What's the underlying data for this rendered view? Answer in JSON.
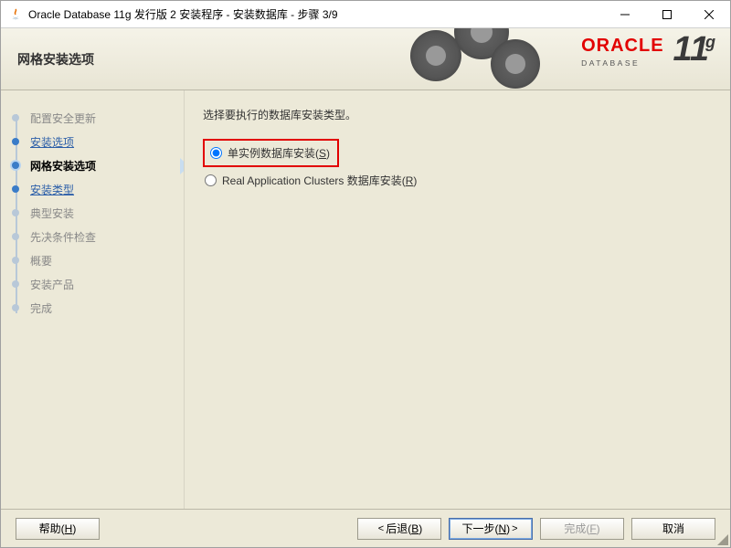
{
  "window": {
    "title": "Oracle Database 11g 发行版 2 安装程序 - 安装数据库 - 步骤 3/9"
  },
  "header": {
    "title": "网格安装选项",
    "logo_brand": "ORACLE",
    "logo_sub": "DATABASE",
    "logo_version": "11",
    "logo_version_suffix": "g"
  },
  "sidebar": {
    "items": [
      {
        "label": "配置安全更新",
        "state": "disabled"
      },
      {
        "label": "安装选项",
        "state": "done"
      },
      {
        "label": "网格安装选项",
        "state": "current"
      },
      {
        "label": "安装类型",
        "state": "done"
      },
      {
        "label": "典型安装",
        "state": "disabled"
      },
      {
        "label": "先决条件检查",
        "state": "disabled"
      },
      {
        "label": "概要",
        "state": "disabled"
      },
      {
        "label": "安装产品",
        "state": "disabled"
      },
      {
        "label": "完成",
        "state": "disabled"
      }
    ]
  },
  "content": {
    "instruction": "选择要执行的数据库安装类型。",
    "option1_label": "单实例数据库安装(",
    "option1_accel": "S",
    "option1_suffix": ")",
    "option2_label": "Real Application Clusters 数据库安装(",
    "option2_accel": "R",
    "option2_suffix": ")",
    "selected": "single"
  },
  "buttons": {
    "help": "帮助(",
    "help_accel": "H",
    "help_suffix": ")",
    "back": "后退(",
    "back_accel": "B",
    "back_suffix": ")",
    "next": "下一步(",
    "next_accel": "N",
    "next_suffix": ")",
    "finish": "完成(",
    "finish_accel": "F",
    "finish_suffix": ")",
    "cancel": "取消"
  }
}
